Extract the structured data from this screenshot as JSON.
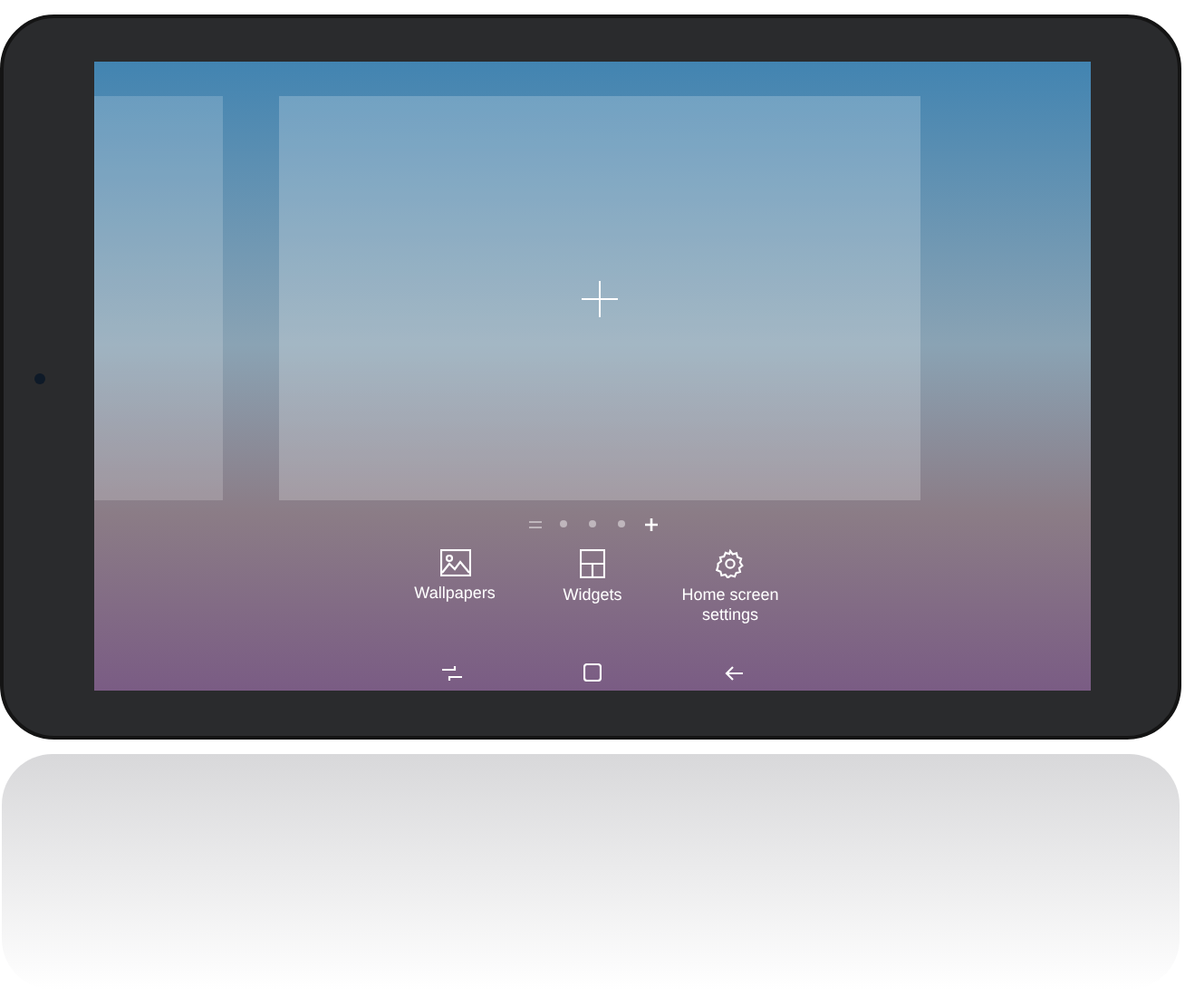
{
  "page_indicators": [
    {
      "kind": "lines",
      "selected": false
    },
    {
      "kind": "dot",
      "selected": false
    },
    {
      "kind": "dot",
      "selected": false
    },
    {
      "kind": "dot",
      "selected": false
    },
    {
      "kind": "plus",
      "selected": true
    }
  ],
  "menu": [
    {
      "kind": "image",
      "label": "Wallpapers"
    },
    {
      "kind": "widgets",
      "label": "Widgets"
    },
    {
      "kind": "gear",
      "label": "Home screen settings"
    }
  ],
  "nav_bar": [
    {
      "kind": "recents"
    },
    {
      "kind": "home"
    },
    {
      "kind": "back"
    }
  ]
}
